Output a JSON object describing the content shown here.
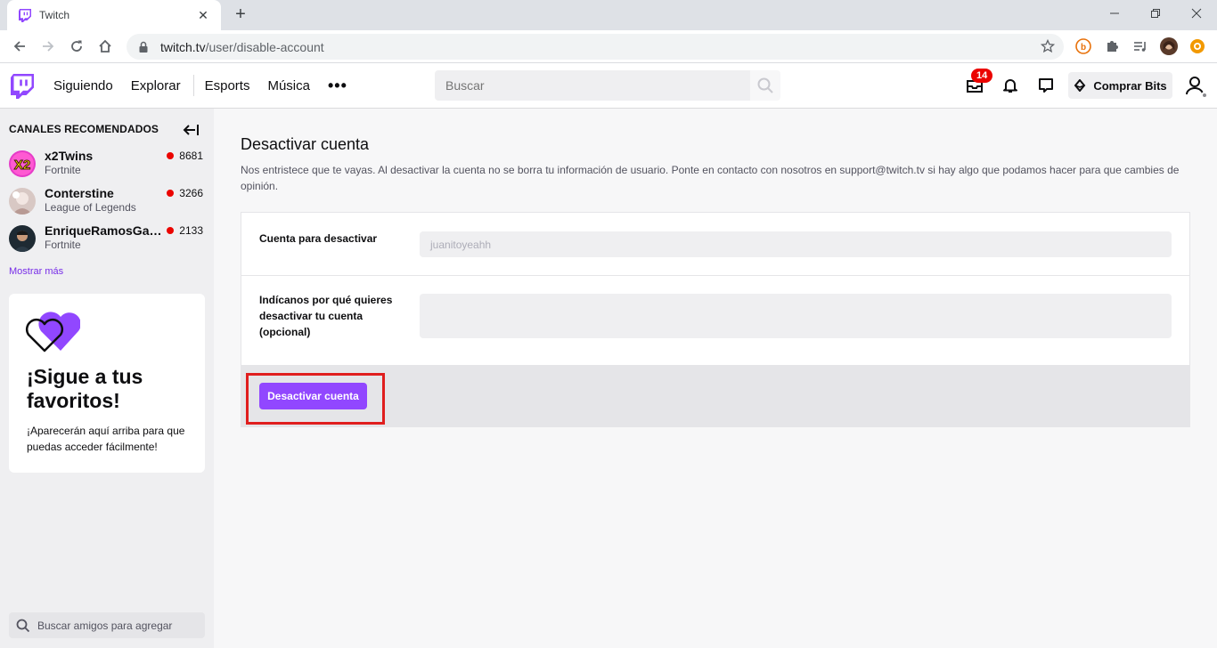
{
  "browser": {
    "tab_title": "Twitch",
    "url_host": "twitch.tv",
    "url_path": "/user/disable-account"
  },
  "topnav": {
    "links": [
      "Siguiendo",
      "Explorar",
      "Esports",
      "Música"
    ],
    "more": "•••",
    "search_placeholder": "Buscar",
    "inbox_badge": "14",
    "bits_label": "Comprar Bits"
  },
  "sidebar": {
    "header": "CANALES RECOMENDADOS",
    "channels": [
      {
        "name": "x2Twins",
        "game": "Fortnite",
        "viewers": "8681"
      },
      {
        "name": "Conterstine",
        "game": "League of Legends",
        "viewers": "3266"
      },
      {
        "name": "EnriqueRamosGam...",
        "game": "Fortnite",
        "viewers": "2133"
      }
    ],
    "show_more": "Mostrar más",
    "promo": {
      "title": "¡Sigue a tus favoritos!",
      "text": "¡Aparecerán aquí arriba para que puedas acceder fácilmente!"
    },
    "friends_placeholder": "Buscar amigos para agregar"
  },
  "main": {
    "title": "Desactivar cuenta",
    "description": "Nos entristece que te vayas. Al desactivar la cuenta no se borra tu información de usuario. Ponte en contacto con nosotros en support@twitch.tv si hay algo que podamos hacer para que cambies de opinión.",
    "account_label": "Cuenta para desactivar",
    "account_value": "juanitoyeahh",
    "reason_label": "Indícanos por qué quieres desactivar tu cuenta (opcional)",
    "reason_value": "",
    "submit_label": "Desactivar cuenta"
  },
  "colors": {
    "brand": "#9147ff",
    "live": "#eb0400",
    "highlight": "#e01e1e"
  }
}
